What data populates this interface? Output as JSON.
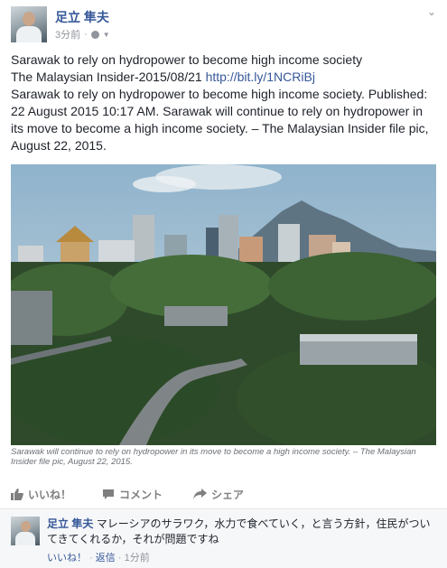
{
  "post": {
    "author": "足立 隼夫",
    "time": "3分前",
    "separator": "·",
    "privacy_icon": "globe-icon",
    "options_icon": "chevron-down-icon",
    "line1": "Sarawak to rely on hydropower to become high income society",
    "line2_text": "The Malaysian Insider-2015/08/21 ",
    "line2_link": "http://bit.ly/1NCRiBj",
    "body": "Sarawak to rely on hydropower to become high income society. Published: 22 August 2015 10:17 AM. Sarawak will continue to rely on hydropower in its move to become a high income society. – The Malaysian Insider file pic, August 22, 2015.",
    "photo_caption": "Sarawak will continue to rely on hydropower in its move to become a high income society. – The Malaysian Insider file pic, August 22, 2015."
  },
  "actions": {
    "like": "いいね！",
    "comment": "コメント",
    "share": "シェア",
    "like_icon": "thumbs-up-icon",
    "comment_icon": "speech-bubble-icon",
    "share_icon": "share-arrow-icon"
  },
  "comment": {
    "author": "足立 隼夫",
    "text": "マレーシアのサラワク，水力で食べていく，と言う方針，住民がついてきてくれるか，それが問題ですね",
    "like": "いいね！",
    "reply": "返信",
    "sep": "·",
    "time": "1分前"
  },
  "colors": {
    "link": "#365899",
    "meta": "#90949c",
    "text": "#1d2129",
    "comment_bg": "#f6f7f9"
  }
}
